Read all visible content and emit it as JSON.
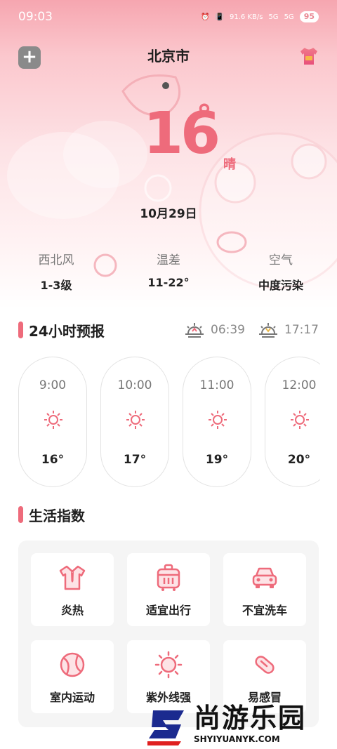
{
  "status_bar": {
    "time": "09:03",
    "network_speed": "91.6 KB/s",
    "signal_1": "5G",
    "signal_2": "5G",
    "battery": "95"
  },
  "header": {
    "city": "北京市"
  },
  "current": {
    "temperature": "16",
    "unit": "°",
    "condition": "晴",
    "date": "10月29日"
  },
  "stats": [
    {
      "label": "西北风",
      "value": "1-3级"
    },
    {
      "label": "温差",
      "value": "11-22°"
    },
    {
      "label": "空气",
      "value": "中度污染"
    }
  ],
  "forecast": {
    "title": "24小时预报",
    "sunrise": "06:39",
    "sunset": "17:17",
    "hours": [
      {
        "time": "9:00",
        "icon": "sun-icon",
        "temp": "16°"
      },
      {
        "time": "10:00",
        "icon": "sun-icon",
        "temp": "17°"
      },
      {
        "time": "11:00",
        "icon": "sun-icon",
        "temp": "19°"
      },
      {
        "time": "12:00",
        "icon": "sun-icon",
        "temp": "20°"
      }
    ]
  },
  "life": {
    "title": "生活指数",
    "items": [
      {
        "label": "炎热",
        "icon": "shirt-icon"
      },
      {
        "label": "适宜出行",
        "icon": "luggage-icon"
      },
      {
        "label": "不宜洗车",
        "icon": "car-icon"
      },
      {
        "label": "室内运动",
        "icon": "ball-icon"
      },
      {
        "label": "紫外线强",
        "icon": "uv-sun-icon"
      },
      {
        "label": "易感冒",
        "icon": "pill-icon"
      }
    ]
  },
  "watermark": {
    "cn": "尚游乐园",
    "en": "SHYIYUANYK.COM"
  },
  "colors": {
    "accent": "#ee6b7b",
    "hero_top": "#f6a6b0"
  }
}
